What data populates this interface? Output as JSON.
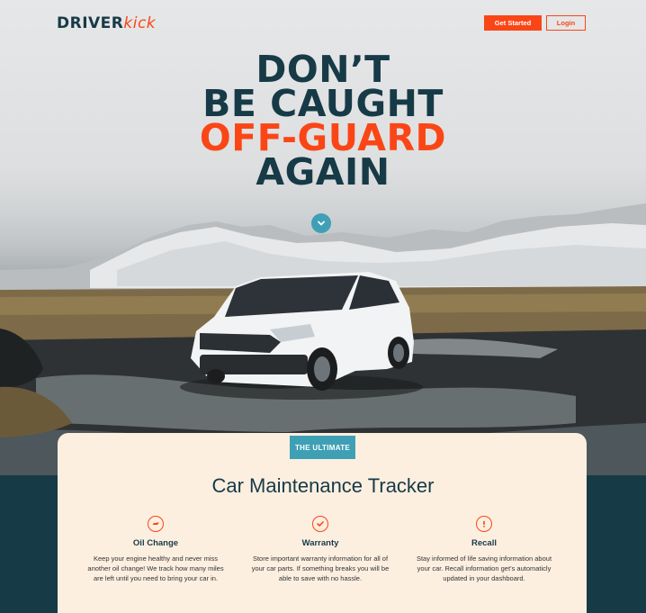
{
  "brand": {
    "name_part1": "DRIVER",
    "name_part2": "kick"
  },
  "header": {
    "get_started_label": "Get Started",
    "login_label": "Login"
  },
  "hero": {
    "line1": "DON’T",
    "line2": "BE CAUGHT",
    "line3": "OFF-GUARD",
    "line4": "AGAIN",
    "scroll_icon": "chevron-down-icon"
  },
  "card": {
    "tag": "THE ULTIMATE",
    "title": "Car Maintenance Tracker",
    "features": [
      {
        "icon": "oil-can-icon",
        "title": "Oil Change",
        "desc": "Keep your engine healthy and never miss another oil change! We track how many miles are left until you need to bring your car in."
      },
      {
        "icon": "checkmark-icon",
        "title": "Warranty",
        "desc": "Store important warranty information for all of your car parts. If something breaks you will be able to save with no hassle."
      },
      {
        "icon": "alert-icon",
        "title": "Recall",
        "desc": "Stay informed of life saving information about your car. Recall information get’s automaticly updated in your dashboard."
      }
    ]
  },
  "colors": {
    "brand_dark": "#173a47",
    "accent_orange": "#fa4616",
    "accent_teal": "#3fa0b5",
    "card_bg": "#fcefe0"
  }
}
